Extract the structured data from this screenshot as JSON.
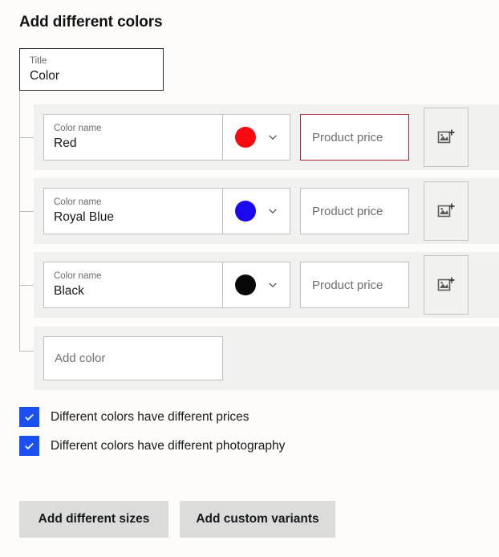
{
  "heading": "Add different colors",
  "title_field": {
    "label": "Title",
    "value": "Color",
    "name": "title-input"
  },
  "color_name_label": "Color name",
  "price_placeholder": "Product price",
  "add_image_icon": "add-image-icon",
  "chevron_icon": "chevron-down-icon",
  "rows": [
    {
      "color_name": "Red",
      "swatch_hex": "#FA0A10",
      "price_value": "",
      "price_error": true
    },
    {
      "color_name": "Royal Blue",
      "swatch_hex": "#1A08EE",
      "price_value": "",
      "price_error": false
    },
    {
      "color_name": "Black",
      "swatch_hex": "#080808",
      "price_value": "",
      "price_error": false
    }
  ],
  "add_color": {
    "placeholder": "Add color"
  },
  "checkboxes": [
    {
      "label": "Different colors have different prices",
      "checked": true
    },
    {
      "label": "Different colors have different photography",
      "checked": true
    }
  ],
  "buttons": [
    {
      "label": "Add different sizes"
    },
    {
      "label": "Add custom variants"
    }
  ],
  "colors": {
    "page_bg": "#FDFCFA",
    "band_bg": "#F1F1EF",
    "accent_blue": "#1B50F0",
    "error_red": "#B22339",
    "button_bg": "#DCDCDA",
    "border_gray": "#BFBFBF",
    "tree_line": "#BDBDBD"
  }
}
